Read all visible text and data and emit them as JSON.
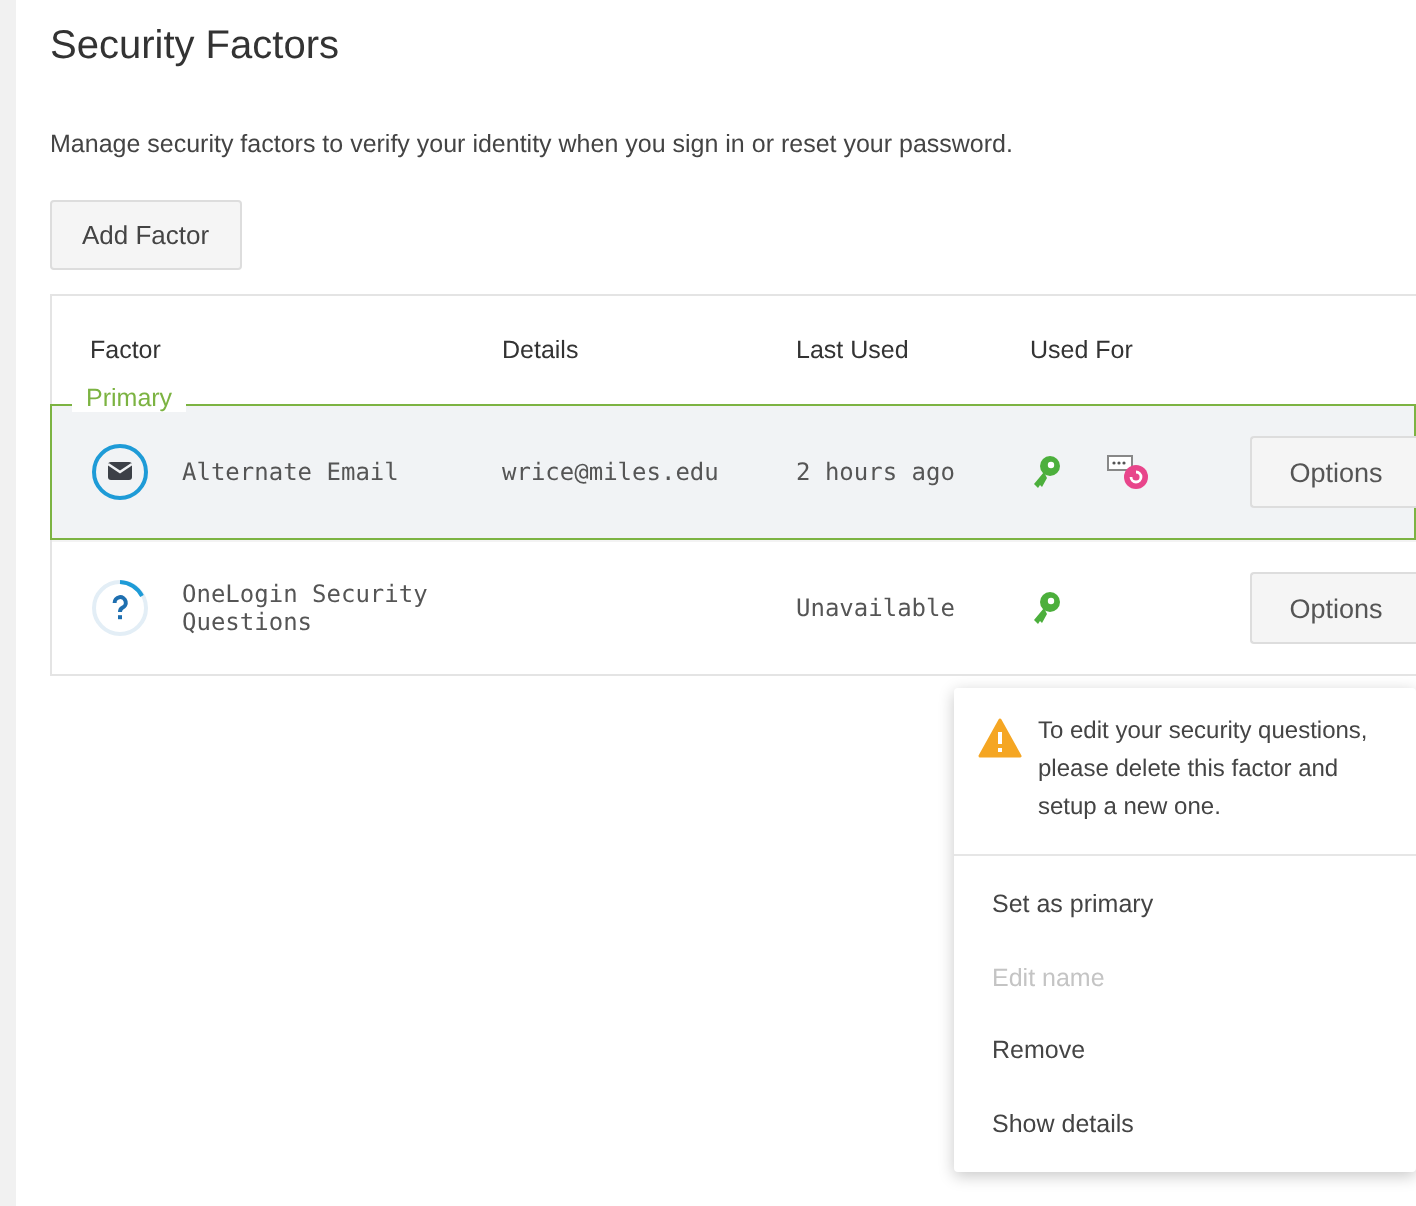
{
  "title": "Security Factors",
  "description": "Manage security factors to verify your identity when you sign in or reset your password.",
  "add_button": "Add Factor",
  "table": {
    "columns": [
      "Factor",
      "Details",
      "Last Used",
      "Used For"
    ],
    "primary_label": "Primary",
    "rows": [
      {
        "kind": "email",
        "name": "Alternate Email",
        "details": "wrice@miles.edu",
        "last_used": "2 hours ago",
        "used_for": [
          {
            "kind": "key"
          },
          {
            "kind": "reset"
          }
        ],
        "primary": true,
        "options": "Options"
      },
      {
        "kind": "question",
        "name": "OneLogin Security Questions",
        "last_used": "Unavailable",
        "used_for": [
          {
            "kind": "key"
          }
        ],
        "primary": false,
        "options": "Options"
      }
    ]
  },
  "menu": {
    "warning": "To edit your security questions, please delete this factor and setup a new one.",
    "items": [
      {
        "label": "Set as primary",
        "disabled": false
      },
      {
        "label": "Edit name",
        "disabled": true
      },
      {
        "label": "Remove",
        "disabled": false
      },
      {
        "label": "Show details",
        "disabled": false
      }
    ]
  }
}
